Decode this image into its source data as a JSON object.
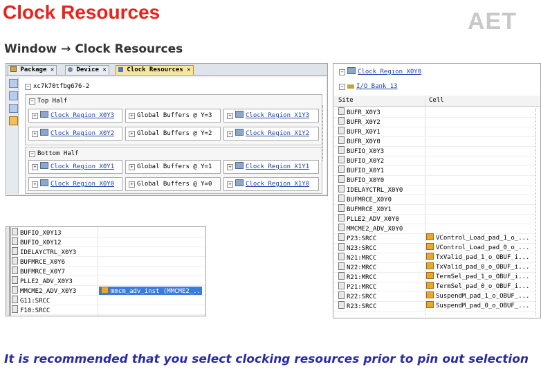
{
  "slide": {
    "title": "Clock Resources",
    "logo": "AET",
    "subtitle": "Window → Clock Resources",
    "footer": "It is recommended that you select clocking resources prior to pin out selection"
  },
  "panel1": {
    "tabs": [
      "Package",
      "Device",
      "Clock Resources"
    ],
    "device": "xc7k70tfbg676-2",
    "top_half": {
      "label": "Top Half",
      "rows": [
        [
          "Clock Region X0Y3",
          "Global Buffers @ Y=3",
          "Clock Region X1Y3"
        ],
        [
          "Clock Region X0Y2",
          "Global Buffers @ Y=2",
          "Clock Region X1Y2"
        ]
      ]
    },
    "bottom_half": {
      "label": "Bottom Half",
      "rows": [
        [
          "Clock Region X0Y1",
          "Global Buffers @ Y=1",
          "Clock Region X1Y1"
        ],
        [
          "Clock Region X0Y0",
          "Global Buffers @ Y=0",
          "Clock Region X1Y0"
        ]
      ]
    }
  },
  "panel2": {
    "rows": [
      "BUFIO_X0Y13",
      "BUFIO_X0Y12",
      "IDELAYCTRL_X0Y3",
      "BUFMRCE_X0Y6",
      "BUFMRCE_X0Y7",
      "PLLE2_ADV_X0Y3",
      "MMCME2_ADV_X0Y3",
      "G11:SRCC",
      "F10:SRCC"
    ],
    "selected_cell": "mmcm_adv_inst (MMCME2_..."
  },
  "panel3": {
    "region": "Clock Region X0Y0",
    "bank": "I/O Bank 13",
    "col_site": "Site",
    "col_cell": "Cell",
    "rows": [
      {
        "site": "BUFR_X0Y3",
        "cell": ""
      },
      {
        "site": "BUFR_X0Y2",
        "cell": ""
      },
      {
        "site": "BUFR_X0Y1",
        "cell": ""
      },
      {
        "site": "BUFR_X0Y0",
        "cell": ""
      },
      {
        "site": "BUFIO_X0Y3",
        "cell": ""
      },
      {
        "site": "BUFIO_X0Y2",
        "cell": ""
      },
      {
        "site": "BUFIO_X0Y1",
        "cell": ""
      },
      {
        "site": "BUFIO_X0Y0",
        "cell": ""
      },
      {
        "site": "IDELAYCTRL_X0Y0",
        "cell": ""
      },
      {
        "site": "BUFMRCE_X0Y0",
        "cell": ""
      },
      {
        "site": "BUFMRCE_X0Y1",
        "cell": ""
      },
      {
        "site": "PLLE2_ADV_X0Y0",
        "cell": ""
      },
      {
        "site": "MMCME2_ADV_X0Y0",
        "cell": ""
      },
      {
        "site": "P23:SRCC",
        "cell": "VControl_Load_pad_1_o_..."
      },
      {
        "site": "N23:SRCC",
        "cell": "VControl_Load_pad_0_o_..."
      },
      {
        "site": "N21:MRCC",
        "cell": "TxValid_pad_1_o_OBUF_i..."
      },
      {
        "site": "N22:MRCC",
        "cell": "TxValid_pad_0_o_OBUF_i..."
      },
      {
        "site": "R21:MRCC",
        "cell": "TermSel_pad_1_o_OBUF_i..."
      },
      {
        "site": "P21:MRCC",
        "cell": "TermSel_pad_0_o_OBUF_i..."
      },
      {
        "site": "R22:SRCC",
        "cell": "SuspendM_pad_1_o_OBUF_..."
      },
      {
        "site": "R23:SRCC",
        "cell": "SuspendM_pad_0_o_OBUF_..."
      }
    ]
  }
}
